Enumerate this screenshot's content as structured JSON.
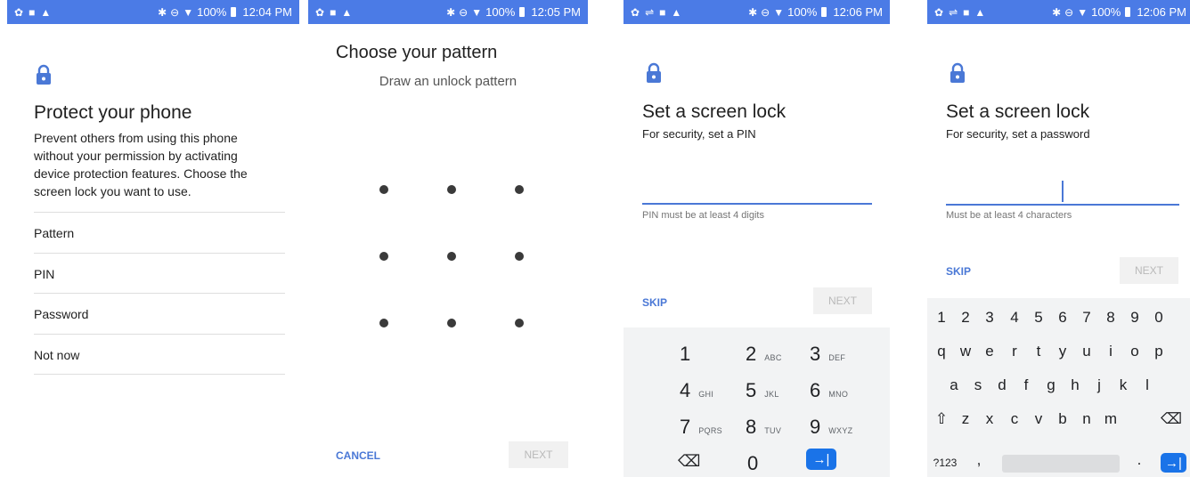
{
  "status_bars": [
    {
      "battery": "100%",
      "time": "12:04 PM"
    },
    {
      "battery": "100%",
      "time": "12:05 PM"
    },
    {
      "battery": "100%",
      "time": "12:06 PM"
    },
    {
      "battery": "100%",
      "time": "12:06 PM"
    }
  ],
  "screen1": {
    "title": "Protect your phone",
    "description": "Prevent others from using this phone without your permission by activating device protection features. Choose the screen lock you want to use.",
    "options": [
      "Pattern",
      "PIN",
      "Password",
      "Not now"
    ]
  },
  "screen2": {
    "title": "Choose your pattern",
    "subtitle": "Draw an unlock pattern",
    "cancel": "CANCEL",
    "next": "NEXT"
  },
  "screen3": {
    "title": "Set a screen lock",
    "subtitle": "For security, set a PIN",
    "hint": "PIN must be at least 4 digits",
    "skip": "SKIP",
    "next": "NEXT",
    "keys": [
      {
        "d": "1",
        "l": ""
      },
      {
        "d": "2",
        "l": "ABC"
      },
      {
        "d": "3",
        "l": "DEF"
      },
      {
        "d": "4",
        "l": "GHI"
      },
      {
        "d": "5",
        "l": "JKL"
      },
      {
        "d": "6",
        "l": "MNO"
      },
      {
        "d": "7",
        "l": "PQRS"
      },
      {
        "d": "8",
        "l": "TUV"
      },
      {
        "d": "9",
        "l": "WXYZ"
      },
      {
        "d": "⌫",
        "l": ""
      },
      {
        "d": "0",
        "l": ""
      },
      {
        "d": "→|",
        "l": ""
      }
    ]
  },
  "screen4": {
    "title": "Set a screen lock",
    "subtitle": "For security, set a password",
    "hint": "Must be at least 4 characters",
    "skip": "SKIP",
    "next": "NEXT",
    "rows": [
      [
        "1",
        "2",
        "3",
        "4",
        "5",
        "6",
        "7",
        "8",
        "9",
        "0"
      ],
      [
        "q",
        "w",
        "e",
        "r",
        "t",
        "y",
        "u",
        "i",
        "o",
        "p"
      ],
      [
        "a",
        "s",
        "d",
        "f",
        "g",
        "h",
        "j",
        "k",
        "l"
      ],
      [
        "⇧",
        "z",
        "x",
        "c",
        "v",
        "b",
        "n",
        "m",
        "⌫"
      ]
    ],
    "bottom": {
      "sym": "?123",
      "comma": ",",
      "period": ".",
      "enter": "→|"
    }
  },
  "colors": {
    "accent": "#4a78d6",
    "statusbar": "#4b7be6"
  }
}
